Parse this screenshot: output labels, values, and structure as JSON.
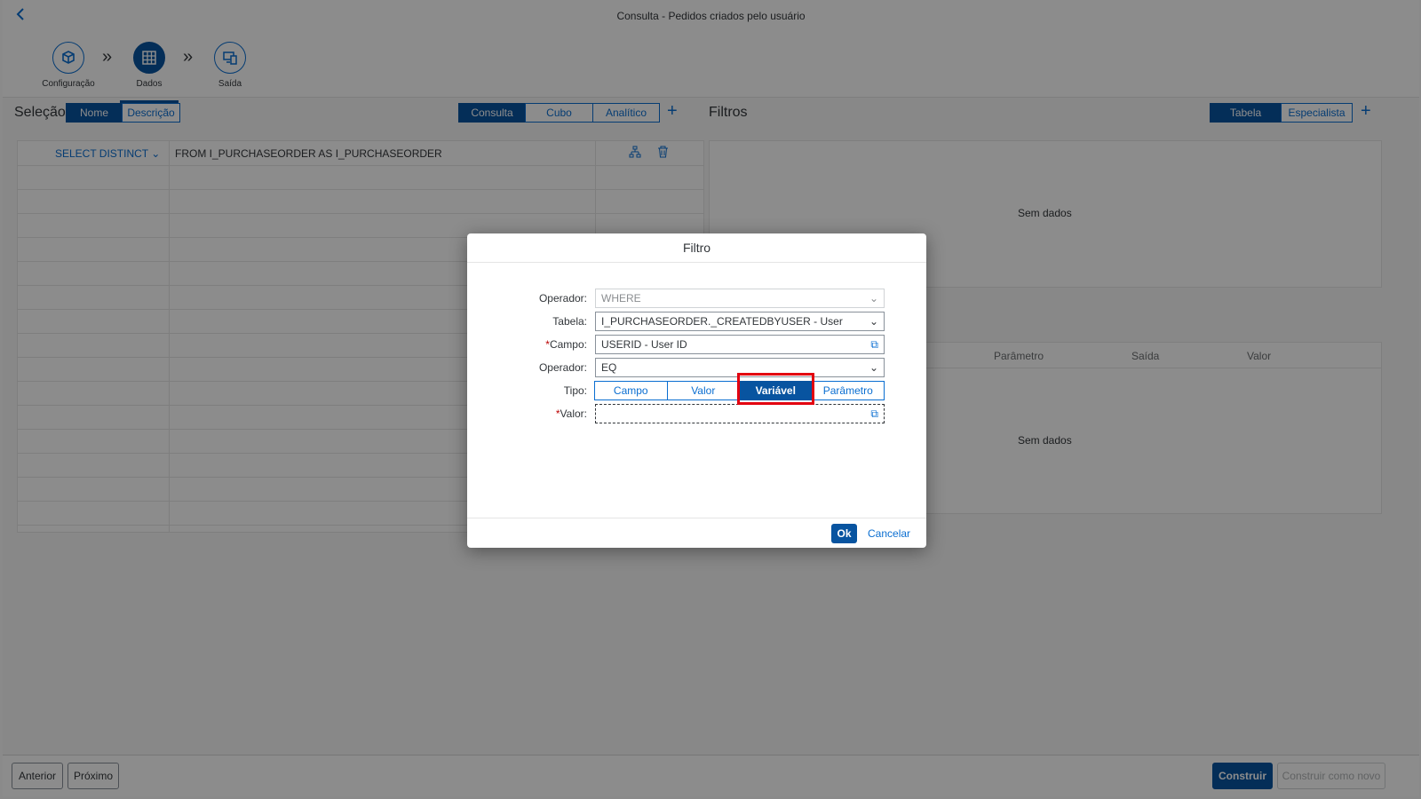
{
  "shell": {
    "title": "Consulta - Pedidos criados pelo usuário",
    "back_icon": "chevron-left-icon"
  },
  "wizard": {
    "steps": [
      {
        "label": "Configuração",
        "icon": "cube-icon",
        "active": false
      },
      {
        "label": "Dados",
        "icon": "table-grid-icon",
        "active": true
      },
      {
        "label": "Saída",
        "icon": "devices-icon",
        "active": false
      }
    ]
  },
  "selection": {
    "title": "Seleção",
    "toggle": [
      "Nome",
      "Descrição"
    ],
    "mode_tabs": [
      "Consulta",
      "Cubo",
      "Analítico"
    ],
    "select_label": "SELECT DISTINCT",
    "from_text": "FROM I_PURCHASEORDER AS I_PURCHASEORDER"
  },
  "filters": {
    "title": "Filtros",
    "toggle": [
      "Tabela",
      "Especialista"
    ],
    "no_data_top": "Sem dados",
    "columns": [
      "Parâmetro",
      "Saída",
      "Valor"
    ],
    "no_data_bottom": "Sem dados"
  },
  "footer": {
    "prev": "Anterior",
    "next": "Próximo",
    "build": "Construir",
    "build_new": "Construir como novo"
  },
  "dialog": {
    "title": "Filtro",
    "fields": {
      "operador1_label": "Operador:",
      "operador1_value": "WHERE",
      "tabela_label": "Tabela:",
      "tabela_value": "I_PURCHASEORDER._CREATEDBYUSER - User",
      "campo_label": "Campo:",
      "campo_value": "USERID - User ID",
      "operador2_label": "Operador:",
      "operador2_value": "EQ",
      "tipo_label": "Tipo:",
      "tipo_options": [
        "Campo",
        "Valor",
        "Variável",
        "Parâmetro"
      ],
      "tipo_selected": "Variável",
      "valor_label": "Valor:",
      "valor_value": ""
    },
    "ok": "Ok",
    "cancel": "Cancelar"
  },
  "colors": {
    "accent": "#0854a0",
    "link": "#0a6ed1",
    "highlight": "#e3000f",
    "required": "#bb0000"
  }
}
